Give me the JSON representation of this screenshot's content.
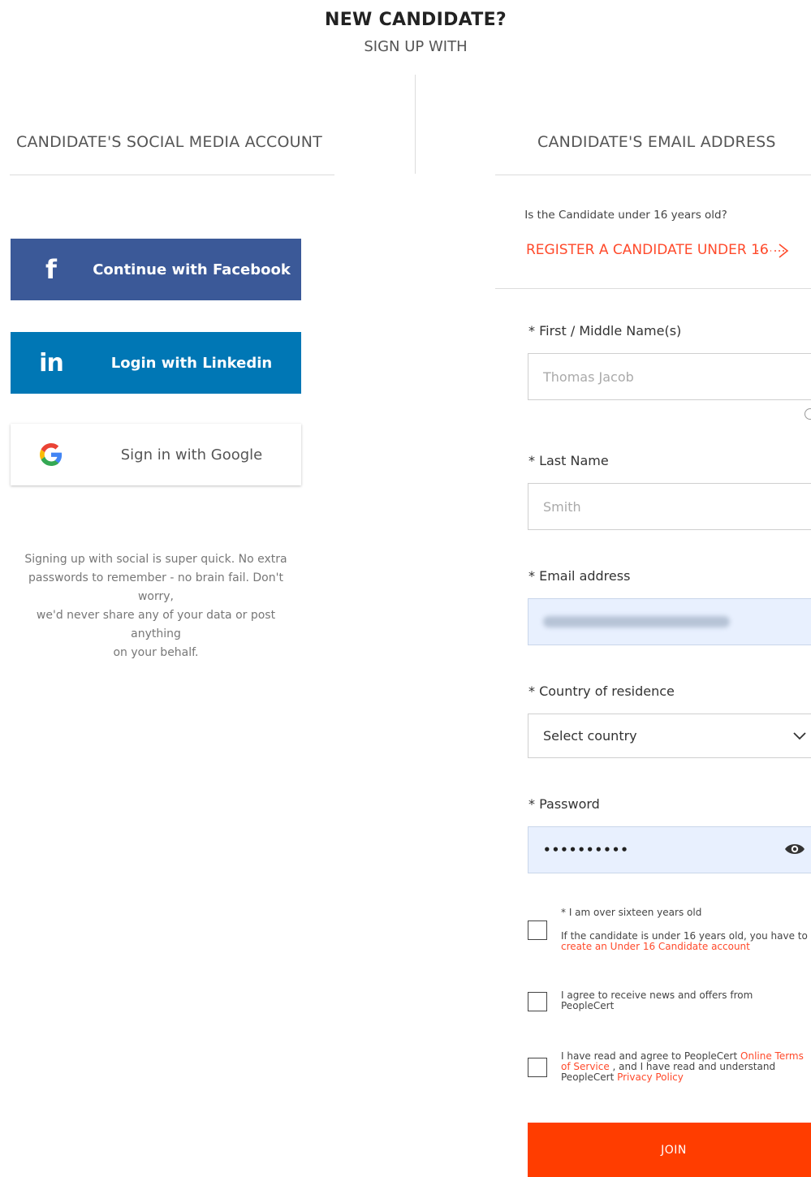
{
  "header": {
    "title": "NEW CANDIDATE?",
    "subtitle": "SIGN UP WITH"
  },
  "social": {
    "heading": "CANDIDATE'S SOCIAL MEDIA ACCOUNT",
    "facebook_label": "Continue with Facebook",
    "linkedin_label": "Login with Linkedin",
    "google_label": "Sign in with Google",
    "note_line1": "Signing up with social is super quick. No extra",
    "note_line2": "passwords to remember - no brain fail. Don't worry,",
    "note_line3": "we'd never share any of your data or post anything",
    "note_line4": "on your behalf.",
    "colors": {
      "facebook": "#3b5998",
      "linkedin": "#0077b5"
    }
  },
  "email_form": {
    "heading": "CANDIDATE'S EMAIL ADDRESS",
    "under16_question": "Is the Candidate under 16 years old?",
    "under16_link": "REGISTER A CANDIDATE UNDER 16",
    "first_name_label": "* First / Middle Name(s)",
    "first_name_placeholder": "Thomas Jacob",
    "last_name_label": "* Last Name",
    "last_name_placeholder": "Smith",
    "email_label": "* Email address",
    "country_label": "* Country of residence",
    "country_value": "Select country",
    "password_label": "* Password",
    "password_value": "••••••••••",
    "over16_label": "* I am over sixteen years old",
    "under16_note_prefix": "If the candidate is under 16 years old, you have to",
    "under16_note_link": "create an Under 16 Candidate account",
    "news_line1": "I agree to receive news and offers from",
    "news_line2": "PeopleCert",
    "terms_prefix": "I have read and agree to PeopleCert ",
    "terms_link_a": "Online Terms",
    "terms_link_b": "of Service",
    "terms_mid": " , and I have read and understand",
    "terms_line3_prefix": "PeopleCert ",
    "privacy_link": "Privacy Policy",
    "join_label": "JOIN",
    "accent_color": "#ff3d00"
  }
}
